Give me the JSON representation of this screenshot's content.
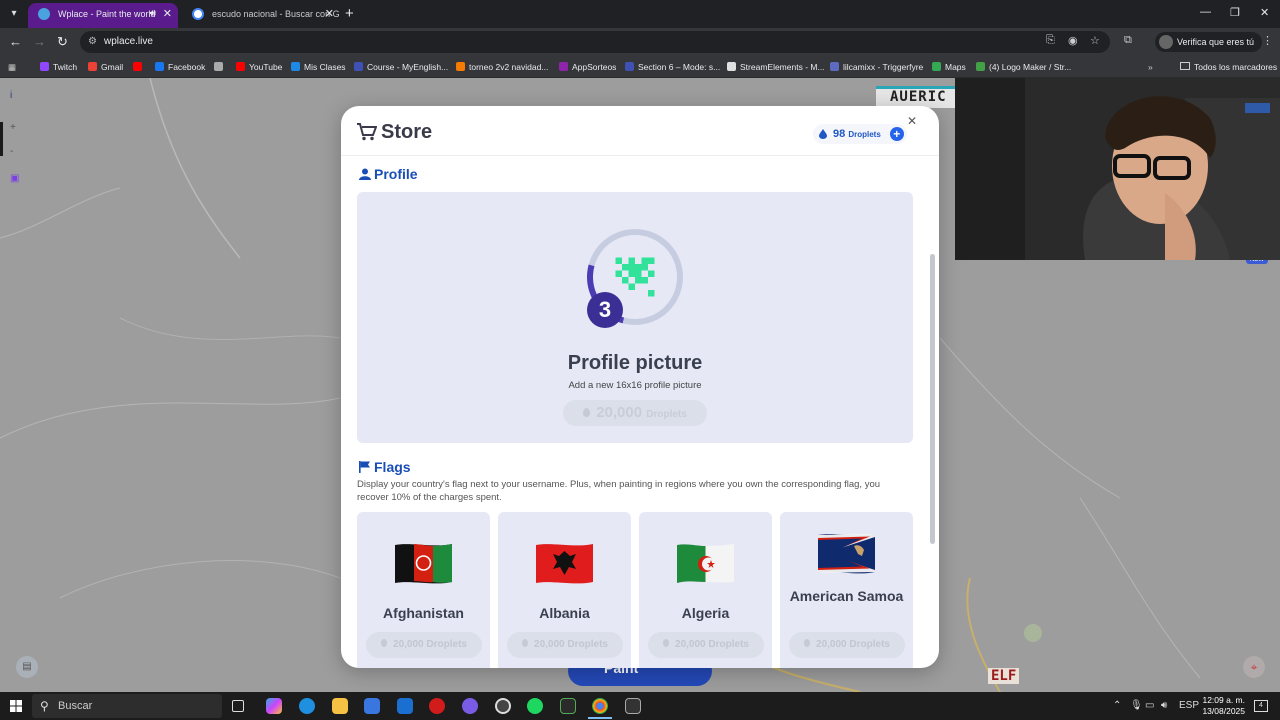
{
  "browser": {
    "tabs": [
      {
        "title": "Wplace - Paint the world",
        "active": true
      },
      {
        "title": "escudo nacional - Buscar con G",
        "active": false
      }
    ],
    "url": "wplace.live",
    "profile_label": "Verifica que eres tú",
    "bookmarks": [
      {
        "label": "Twitch",
        "color": "#9146ff"
      },
      {
        "label": "Gmail",
        "color": "#ea4335"
      },
      {
        "label": "",
        "color": "#ff0000"
      },
      {
        "label": "Facebook",
        "color": "#1877f2"
      },
      {
        "label": "",
        "color": "#aaaaaa"
      },
      {
        "label": "YouTube",
        "color": "#ff0000"
      },
      {
        "label": "Mis Clases",
        "color": "#1e88e5"
      },
      {
        "label": "Course - MyEnglish...",
        "color": "#3f51b5"
      },
      {
        "label": "torneo 2v2 navidad...",
        "color": "#f57c00"
      },
      {
        "label": "AppSorteos",
        "color": "#8e24aa"
      },
      {
        "label": "Section 6 – Mode: s...",
        "color": "#3f51b5"
      },
      {
        "label": "StreamElements - M...",
        "color": "#e0e0e0"
      },
      {
        "label": "lilcamixx - Triggerfyre",
        "color": "#5c6bc0"
      },
      {
        "label": "Maps",
        "color": "#34a853"
      },
      {
        "label": "(4) Logo Maker / Str...",
        "color": "#43a047"
      }
    ],
    "all_bookmarks": "Todos los marcadores"
  },
  "map": {
    "tile_text": "AUERIC",
    "badge_new": "NEW",
    "paint_label": "Paint"
  },
  "store": {
    "title": "Store",
    "droplets_count": "98",
    "droplets_unit": "Droplets",
    "profile_section": {
      "title": "Profile",
      "level": "3",
      "card_title": "Profile picture",
      "card_subtitle": "Add a new 16x16 profile picture",
      "price_value": "20,000",
      "price_unit": "Droplets"
    },
    "flags_section": {
      "title": "Flags",
      "description": "Display your country's flag next to your username. Plus, when painting in regions where you own the corresponding flag, you recover 10% of the charges spent.",
      "items": [
        {
          "name": "Afghanistan",
          "price": "20,000 Droplets"
        },
        {
          "name": "Albania",
          "price": "20,000 Droplets"
        },
        {
          "name": "Algeria",
          "price": "20,000 Droplets"
        },
        {
          "name": "American Samoa",
          "price": "20,000 Droplets"
        }
      ]
    }
  },
  "taskbar": {
    "search_placeholder": "Buscar",
    "language": "ESP",
    "time": "12:09 a. m.",
    "date": "13/08/2025",
    "notifications": "4"
  }
}
